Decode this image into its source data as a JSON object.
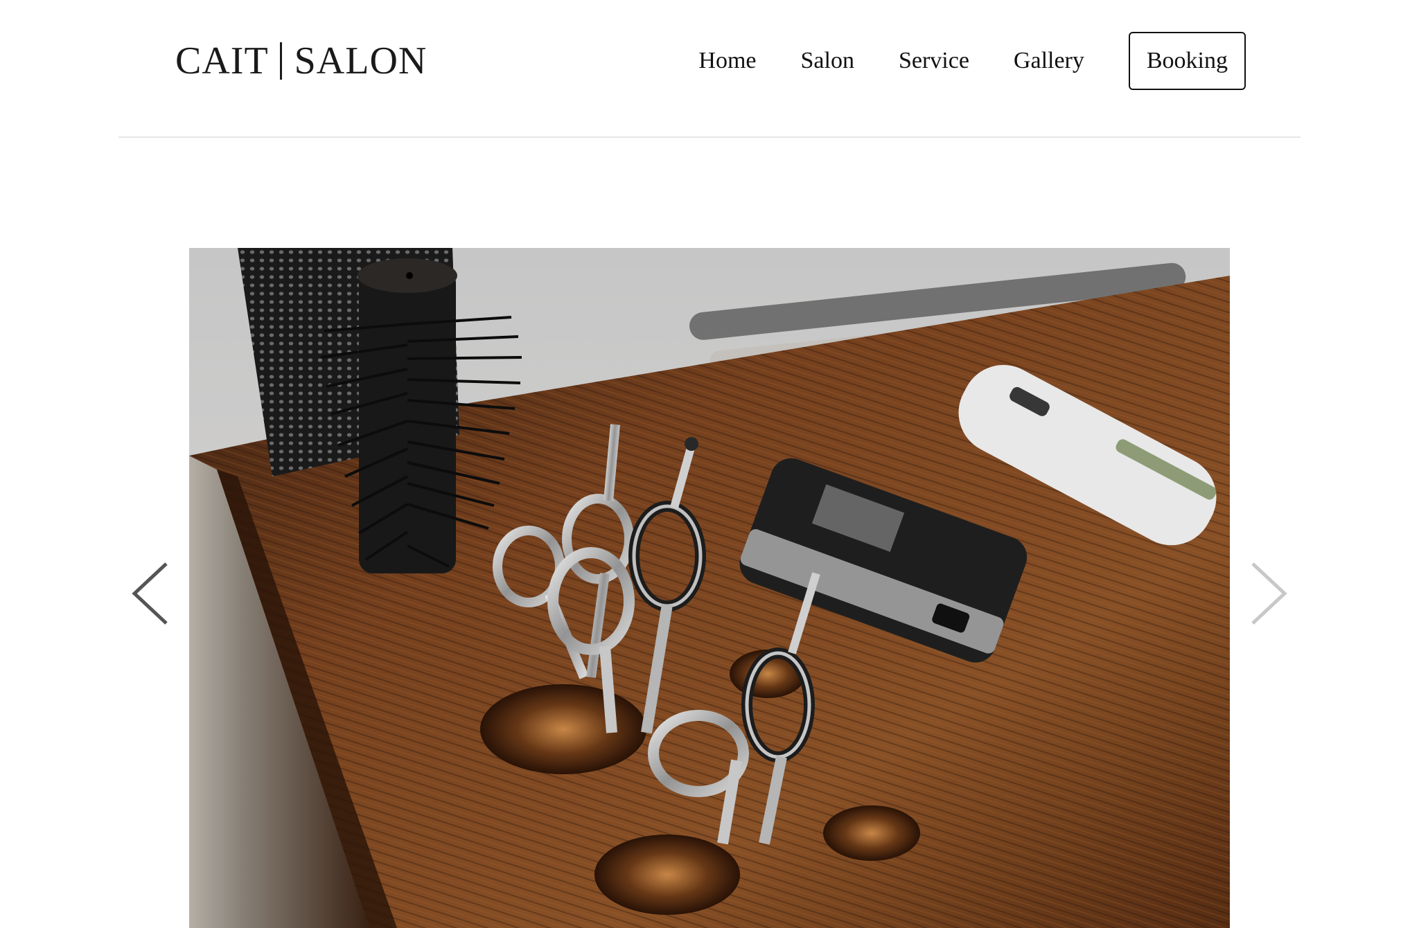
{
  "brand": {
    "name_left": "CAIT",
    "name_right": "SALON"
  },
  "nav": {
    "items": [
      {
        "label": "Home"
      },
      {
        "label": "Salon"
      },
      {
        "label": "Service"
      },
      {
        "label": "Gallery"
      }
    ],
    "booking_label": "Booking"
  },
  "slider": {
    "image_icon": "salon-tools-photo",
    "prev_icon": "chevron-left-icon",
    "next_icon": "chevron-right-icon"
  },
  "colors": {
    "text": "#111111",
    "divider": "#e6e6e6",
    "wood": "#6b3a1c",
    "background": "#ffffff"
  }
}
